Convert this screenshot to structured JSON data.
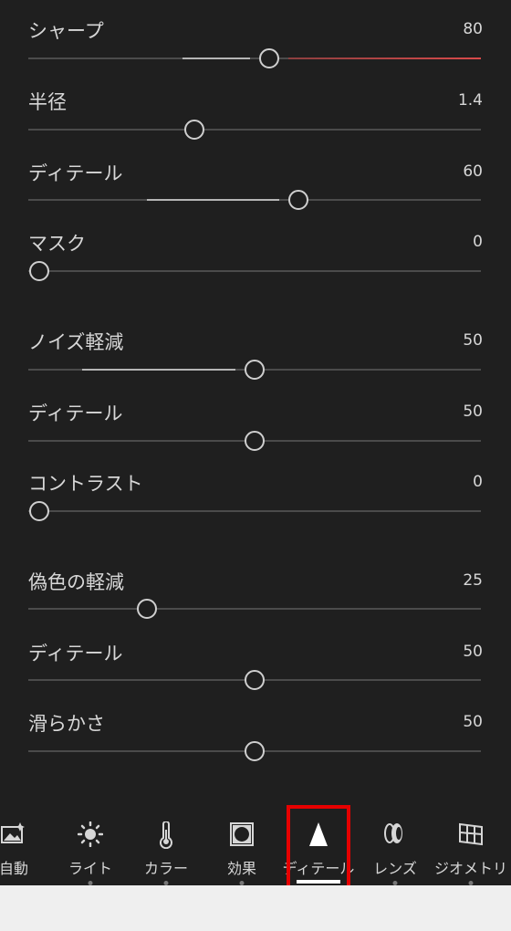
{
  "sliders": [
    {
      "label": "シャープ",
      "value": "80"
    },
    {
      "label": "半径",
      "value": "1.4"
    },
    {
      "label": "ディテール",
      "value": "60"
    },
    {
      "label": "マスク",
      "value": "0"
    },
    {
      "label": "ノイズ軽減",
      "value": "50"
    },
    {
      "label": "ディテール",
      "value": "50"
    },
    {
      "label": "コントラスト",
      "value": "0"
    },
    {
      "label": "偽色の軽減",
      "value": "25"
    },
    {
      "label": "ディテール",
      "value": "50"
    },
    {
      "label": "滑らかさ",
      "value": "50"
    }
  ],
  "toolbar": {
    "items": [
      {
        "label": "自動",
        "icon": "auto-icon"
      },
      {
        "label": "ライト",
        "icon": "sun-icon"
      },
      {
        "label": "カラー",
        "icon": "thermometer-icon"
      },
      {
        "label": "効果",
        "icon": "vignette-icon"
      },
      {
        "label": "ディテール",
        "icon": "triangle-icon",
        "active": true
      },
      {
        "label": "レンズ",
        "icon": "lens-icon"
      },
      {
        "label": "ジオメトリ",
        "icon": "grid-icon"
      }
    ]
  },
  "colors": {
    "background": "#1f1f1f",
    "highlight": "#e60000",
    "accent_red": "#d94a4a"
  }
}
